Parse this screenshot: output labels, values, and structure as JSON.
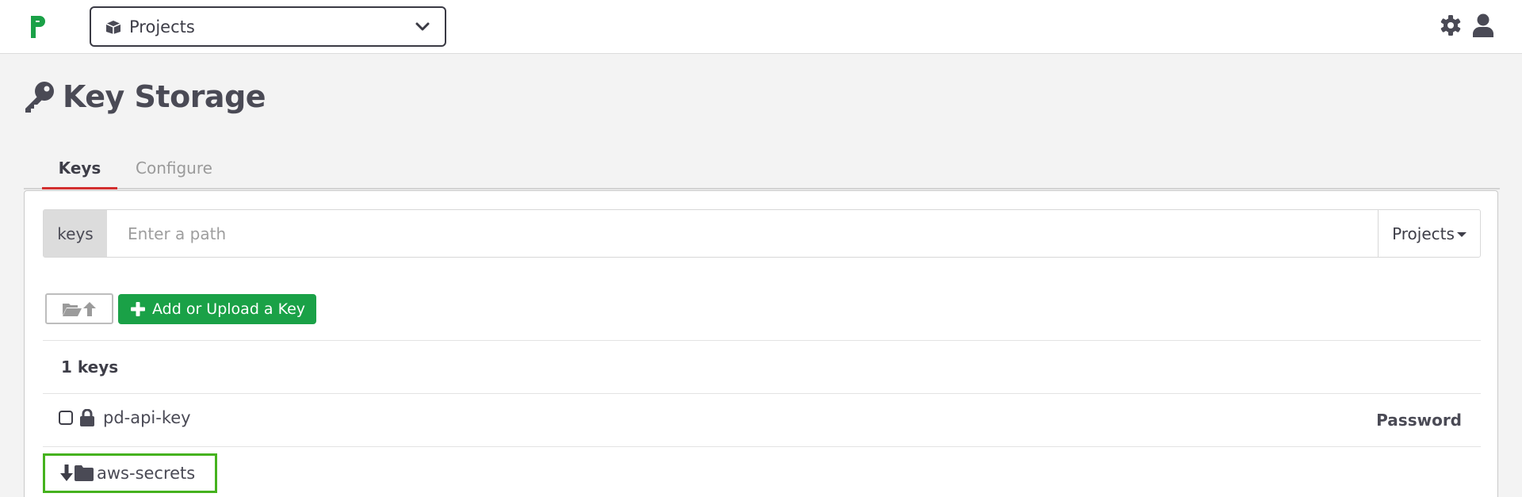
{
  "app": {
    "logo_letter": "P"
  },
  "header": {
    "project_selector": {
      "label": "Projects",
      "icon": "cube-icon"
    },
    "icons": [
      "gear-icon",
      "user-icon"
    ]
  },
  "page": {
    "title": "Key Storage",
    "icon": "key-icon"
  },
  "tabs": [
    {
      "label": "Keys",
      "active": true
    },
    {
      "label": "Configure",
      "active": false
    }
  ],
  "path_bar": {
    "prefix": "keys",
    "placeholder": "Enter a path",
    "value": "",
    "dropdown_label": "Projects"
  },
  "toolbar": {
    "up_button_icon": "folder-open-up-icon",
    "add_button_label": "Add or Upload a Key"
  },
  "listing": {
    "count_text": "1 keys",
    "entries": [
      {
        "type": "key",
        "name": "pd-api-key",
        "key_type": "Password",
        "icon": "lock-icon"
      },
      {
        "type": "folder",
        "name": "aws-secrets",
        "icon": "folder-icon",
        "highlighted": true
      }
    ]
  },
  "colors": {
    "primary_green": "#1aa147",
    "highlight_green": "#45b21e",
    "tab_active_underline": "#d32f2f",
    "text_dark": "#4a4a55",
    "background": "#f3f3f3"
  }
}
